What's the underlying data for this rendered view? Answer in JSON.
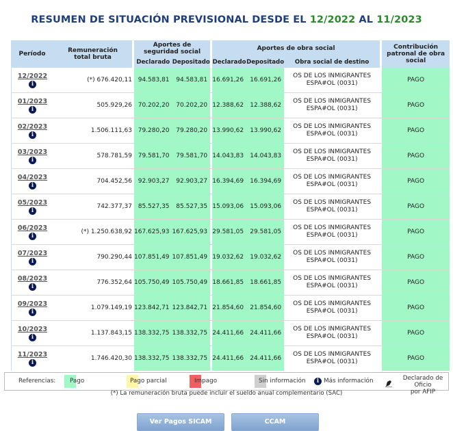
{
  "title": {
    "prefix": "RESUMEN DE SITUACIÓN PREVISIONAL DESDE EL ",
    "from": "12/2022",
    "middle": " AL ",
    "to": "11/2023"
  },
  "headers": {
    "periodo": "Período",
    "remuneracion": "Remuneración total bruta",
    "aportes_ss": "Aportes de seguridad social",
    "aportes_os": "Aportes de obra social",
    "declarado": "Declarado",
    "depositado": "Depositado",
    "obra_social_destino": "Obra social de destino",
    "contribucion": "Contribución patronal de obra social"
  },
  "rows": [
    {
      "period": "12/2022",
      "mark": "(*)",
      "rem": "676.420,11",
      "ss_dec": "94.583,81",
      "ss_dep": "94.583,81",
      "os_dec": "16.691,26",
      "os_dep": "16.691,26",
      "os_name": "OS DE LOS INMIGRANTES",
      "os_code": "ESPA#OL (0031)",
      "contrib": "PAGO"
    },
    {
      "period": "01/2023",
      "mark": "",
      "rem": "505.929,26",
      "ss_dec": "70.202,20",
      "ss_dep": "70.202,20",
      "os_dec": "12.388,62",
      "os_dep": "12.388,62",
      "os_name": "OS DE LOS INMIGRANTES",
      "os_code": "ESPA#OL (0031)",
      "contrib": "PAGO"
    },
    {
      "period": "02/2023",
      "mark": "",
      "rem": "1.506.111,63",
      "ss_dec": "79.280,20",
      "ss_dep": "79.280,20",
      "os_dec": "13.990,62",
      "os_dep": "13.990,62",
      "os_name": "OS DE LOS INMIGRANTES",
      "os_code": "ESPA#OL (0031)",
      "contrib": "PAGO"
    },
    {
      "period": "03/2023",
      "mark": "",
      "rem": "578.781,59",
      "ss_dec": "79.581,70",
      "ss_dep": "79.581,70",
      "os_dec": "14.043,83",
      "os_dep": "14.043,83",
      "os_name": "OS DE LOS INMIGRANTES",
      "os_code": "ESPA#OL (0031)",
      "contrib": "PAGO"
    },
    {
      "period": "04/2023",
      "mark": "",
      "rem": "704.452,56",
      "ss_dec": "92.903,27",
      "ss_dep": "92.903,27",
      "os_dec": "16.394,69",
      "os_dep": "16.394,69",
      "os_name": "OS DE LOS INMIGRANTES",
      "os_code": "ESPA#OL (0031)",
      "contrib": "PAGO"
    },
    {
      "period": "05/2023",
      "mark": "",
      "rem": "742.377,37",
      "ss_dec": "85.527,35",
      "ss_dep": "85.527,35",
      "os_dec": "15.093,06",
      "os_dep": "15.093,06",
      "os_name": "OS DE LOS INMIGRANTES",
      "os_code": "ESPA#OL (0031)",
      "contrib": "PAGO"
    },
    {
      "period": "06/2023",
      "mark": "(*)",
      "rem": "1.250.638,92",
      "ss_dec": "167.625,93",
      "ss_dep": "167.625,93",
      "os_dec": "29.581,05",
      "os_dep": "29.581,05",
      "os_name": "OS DE LOS INMIGRANTES",
      "os_code": "ESPA#OL (0031)",
      "contrib": "PAGO"
    },
    {
      "period": "07/2023",
      "mark": "",
      "rem": "790.290,44",
      "ss_dec": "107.851,49",
      "ss_dep": "107.851,49",
      "os_dec": "19.032,62",
      "os_dep": "19.032,62",
      "os_name": "OS DE LOS INMIGRANTES",
      "os_code": "ESPA#OL (0031)",
      "contrib": "PAGO"
    },
    {
      "period": "08/2023",
      "mark": "",
      "rem": "776.352,64",
      "ss_dec": "105.750,49",
      "ss_dep": "105.750,49",
      "os_dec": "18.661,85",
      "os_dep": "18.661,85",
      "os_name": "OS DE LOS INMIGRANTES",
      "os_code": "ESPA#OL (0031)",
      "contrib": "PAGO"
    },
    {
      "period": "09/2023",
      "mark": "",
      "rem": "1.079.149,19",
      "ss_dec": "123.842,71",
      "ss_dep": "123.842,71",
      "os_dec": "21.854,60",
      "os_dep": "21.854,60",
      "os_name": "OS DE LOS INMIGRANTES",
      "os_code": "ESPA#OL (0031)",
      "contrib": "PAGO"
    },
    {
      "period": "10/2023",
      "mark": "",
      "rem": "1.137.843,15",
      "ss_dec": "138.332,75",
      "ss_dep": "138.332,75",
      "os_dec": "24.411,66",
      "os_dep": "24.411,66",
      "os_name": "OS DE LOS INMIGRANTES",
      "os_code": "ESPA#OL (0031)",
      "contrib": "PAGO"
    },
    {
      "period": "11/2023",
      "mark": "",
      "rem": "1.746.420,30",
      "ss_dec": "138.332,75",
      "ss_dep": "138.332,75",
      "os_dec": "24.411,66",
      "os_dep": "24.411,66",
      "os_name": "OS DE LOS INMIGRANTES",
      "os_code": "ESPA#OL (0031)",
      "contrib": "PAGO"
    }
  ],
  "info_glyph": "i",
  "legend": {
    "label": "Referencias:",
    "pago": "Pago",
    "pago_parcial": "Pago parcial",
    "impago": "Impago",
    "sin_info": "Sin información",
    "mas_info": "Más información",
    "declarado_oficio_1": "Declarado de Oficio",
    "declarado_oficio_2": "por AFIP",
    "colors": {
      "pago": "#a1f7c6",
      "pago_parcial": "#fff7a6",
      "impago": "#f06060",
      "sin_info": "#cfcfcf"
    }
  },
  "note": "(*) La remuneración bruta puede incluir el sueldo anual complementario (SAC)",
  "buttons": {
    "sicam": "Ver Pagos SICAM",
    "ccam": "CCAM"
  }
}
